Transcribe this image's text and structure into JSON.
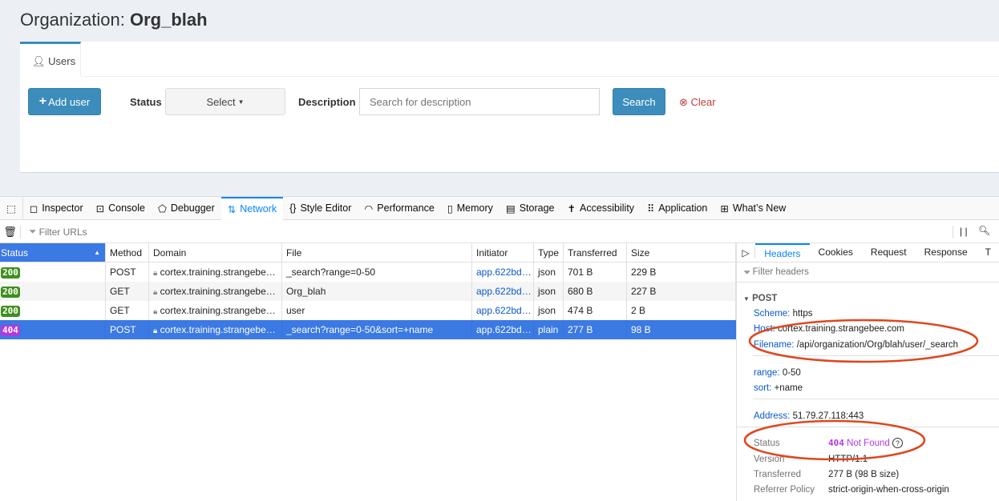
{
  "page": {
    "title_prefix": "Organization:",
    "org_name": "Org_blah"
  },
  "tabs": [
    {
      "label": "Users",
      "icon": "user-icon"
    }
  ],
  "controls": {
    "add_user": "Add user",
    "status_label": "Status",
    "status_select": "Select",
    "description_label": "Description",
    "description_placeholder": "Search for description",
    "search": "Search",
    "clear": "Clear"
  },
  "devtools": {
    "tools": [
      {
        "label": "Inspector",
        "icon": "inspector-icon"
      },
      {
        "label": "Console",
        "icon": "console-icon"
      },
      {
        "label": "Debugger",
        "icon": "debugger-icon"
      },
      {
        "label": "Network",
        "icon": "network-icon",
        "selected": true
      },
      {
        "label": "Style Editor",
        "icon": "braces-icon"
      },
      {
        "label": "Performance",
        "icon": "gauge-icon"
      },
      {
        "label": "Memory",
        "icon": "chip-icon"
      },
      {
        "label": "Storage",
        "icon": "storage-icon"
      },
      {
        "label": "Accessibility",
        "icon": "accessibility-icon"
      },
      {
        "label": "Application",
        "icon": "grid-icon"
      },
      {
        "label": "What’s New",
        "icon": "gift-icon"
      }
    ],
    "filter_placeholder": "Filter URLs",
    "columns": [
      "Status",
      "Method",
      "Domain",
      "File",
      "Initiator",
      "Type",
      "Transferred",
      "Size"
    ],
    "rows": [
      {
        "status": "200",
        "method": "POST",
        "domain": "cortex.training.strangebe…",
        "file": "_search?range=0-50",
        "initiator": "app.622bd…",
        "type": "json",
        "transferred": "701 B",
        "size": "229 B"
      },
      {
        "status": "200",
        "method": "GET",
        "domain": "cortex.training.strangebe…",
        "file": "Org_blah",
        "initiator": "app.622bd…",
        "type": "json",
        "transferred": "680 B",
        "size": "227 B"
      },
      {
        "status": "200",
        "method": "GET",
        "domain": "cortex.training.strangebe…",
        "file": "user",
        "initiator": "app.622bd…",
        "type": "json",
        "transferred": "474 B",
        "size": "2 B"
      },
      {
        "status": "404",
        "method": "POST",
        "domain": "cortex.training.strangebe…",
        "file": "_search?range=0-50&sort=+name",
        "initiator": "app.622bd…",
        "type": "plain",
        "transferred": "277 B",
        "size": "98 B",
        "selected": true
      }
    ],
    "colors": {
      "ok": "#3f8f1d",
      "notfound": "#b338e0",
      "selected": "#3b79e3",
      "accent": "#0a84ff"
    },
    "side": {
      "tabs": [
        "Headers",
        "Cookies",
        "Request",
        "Response",
        "T"
      ],
      "filter_placeholder": "Filter headers",
      "method": "POST",
      "scheme_k": "Scheme:",
      "scheme_v": "https",
      "host_k": "Host:",
      "host_v": "cortex.training.strangebee.com",
      "filename_k": "Filename:",
      "filename_v": "/api/organization/Org/blah/user/_search",
      "range_k": "range:",
      "range_v": "0-50",
      "sort_k": "sort:",
      "sort_v": "+name",
      "address_k": "Address:",
      "address_v": "51.79.27.118:443",
      "status_k": "Status",
      "status_code": "404",
      "status_text": "Not Found",
      "version_k": "Version",
      "version_v": "HTTP/1.1",
      "transferred_k": "Transferred",
      "transferred_v": "277 B (98 B size)",
      "referrer_k": "Referrer Policy",
      "referrer_v": "strict-origin-when-cross-origin"
    }
  }
}
